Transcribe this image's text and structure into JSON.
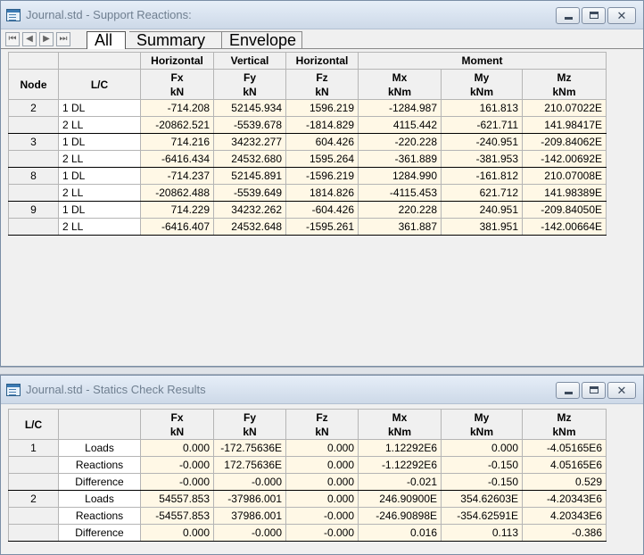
{
  "reactions_window": {
    "title": "Journal.std - Support Reactions:",
    "tabs": [
      "All",
      "Summary",
      "Envelope"
    ],
    "group_headers": [
      "Horizontal",
      "Vertical",
      "Horizontal",
      "Moment"
    ],
    "columns": [
      {
        "name": "Node",
        "unit": ""
      },
      {
        "name": "L/C",
        "unit": ""
      },
      {
        "name": "Fx",
        "unit": "kN"
      },
      {
        "name": "Fy",
        "unit": "kN"
      },
      {
        "name": "Fz",
        "unit": "kN"
      },
      {
        "name": "Mx",
        "unit": "kNm"
      },
      {
        "name": "My",
        "unit": "kNm"
      },
      {
        "name": "Mz",
        "unit": "kNm"
      }
    ],
    "rows": [
      {
        "node": "2",
        "lc": "1 DL",
        "fx": "-714.208",
        "fy": "52145.934",
        "fz": "1596.219",
        "mx": "-1284.987",
        "my": "161.813",
        "mz": "210.07022E"
      },
      {
        "node": "",
        "lc": "2 LL",
        "fx": "-20862.521",
        "fy": "-5539.678",
        "fz": "-1814.829",
        "mx": "4115.442",
        "my": "-621.711",
        "mz": "141.98417E"
      },
      {
        "node": "3",
        "lc": "1 DL",
        "fx": "714.216",
        "fy": "34232.277",
        "fz": "604.426",
        "mx": "-220.228",
        "my": "-240.951",
        "mz": "-209.84062E"
      },
      {
        "node": "",
        "lc": "2 LL",
        "fx": "-6416.434",
        "fy": "24532.680",
        "fz": "1595.264",
        "mx": "-361.889",
        "my": "-381.953",
        "mz": "-142.00692E"
      },
      {
        "node": "8",
        "lc": "1 DL",
        "fx": "-714.237",
        "fy": "52145.891",
        "fz": "-1596.219",
        "mx": "1284.990",
        "my": "-161.812",
        "mz": "210.07008E"
      },
      {
        "node": "",
        "lc": "2 LL",
        "fx": "-20862.488",
        "fy": "-5539.649",
        "fz": "1814.826",
        "mx": "-4115.453",
        "my": "621.712",
        "mz": "141.98389E"
      },
      {
        "node": "9",
        "lc": "1 DL",
        "fx": "714.229",
        "fy": "34232.262",
        "fz": "-604.426",
        "mx": "220.228",
        "my": "240.951",
        "mz": "-209.84050E"
      },
      {
        "node": "",
        "lc": "2 LL",
        "fx": "-6416.407",
        "fy": "24532.648",
        "fz": "-1595.261",
        "mx": "361.887",
        "my": "381.951",
        "mz": "-142.00664E"
      }
    ]
  },
  "statics_window": {
    "title": "Journal.std - Statics Check Results",
    "columns": [
      {
        "name": "L/C",
        "unit": ""
      },
      {
        "name": "",
        "unit": ""
      },
      {
        "name": "Fx",
        "unit": "kN"
      },
      {
        "name": "Fy",
        "unit": "kN"
      },
      {
        "name": "Fz",
        "unit": "kN"
      },
      {
        "name": "Mx",
        "unit": "kNm"
      },
      {
        "name": "My",
        "unit": "kNm"
      },
      {
        "name": "Mz",
        "unit": "kNm"
      }
    ],
    "rows": [
      {
        "lc": "1",
        "label": "Loads",
        "fx": "0.000",
        "fy": "-172.75636E",
        "fz": "0.000",
        "mx": "1.12292E6",
        "my": "0.000",
        "mz": "-4.05165E6"
      },
      {
        "lc": "",
        "label": "Reactions",
        "fx": "-0.000",
        "fy": "172.75636E",
        "fz": "0.000",
        "mx": "-1.12292E6",
        "my": "-0.150",
        "mz": "4.05165E6"
      },
      {
        "lc": "",
        "label": "Difference",
        "fx": "-0.000",
        "fy": "-0.000",
        "fz": "0.000",
        "mx": "-0.021",
        "my": "-0.150",
        "mz": "0.529"
      },
      {
        "lc": "2",
        "label": "Loads",
        "fx": "54557.853",
        "fy": "-37986.001",
        "fz": "0.000",
        "mx": "246.90900E",
        "my": "354.62603E",
        "mz": "-4.20343E6"
      },
      {
        "lc": "",
        "label": "Reactions",
        "fx": "-54557.853",
        "fy": "37986.001",
        "fz": "-0.000",
        "mx": "-246.90898E",
        "my": "-354.62591E",
        "mz": "4.20343E6"
      },
      {
        "lc": "",
        "label": "Difference",
        "fx": "0.000",
        "fy": "-0.000",
        "fz": "-0.000",
        "mx": "0.016",
        "my": "0.113",
        "mz": "-0.386"
      }
    ]
  },
  "icons": {
    "app": "table-window-icon",
    "minimize": "minimize-icon",
    "maximize": "maximize-icon",
    "close": "close-icon",
    "nav": [
      "first-page-icon",
      "prev-page-icon",
      "next-page-icon",
      "last-page-icon"
    ]
  },
  "colors": {
    "cell_background": "#fff8e6",
    "header_background": "#f0f0f0"
  }
}
